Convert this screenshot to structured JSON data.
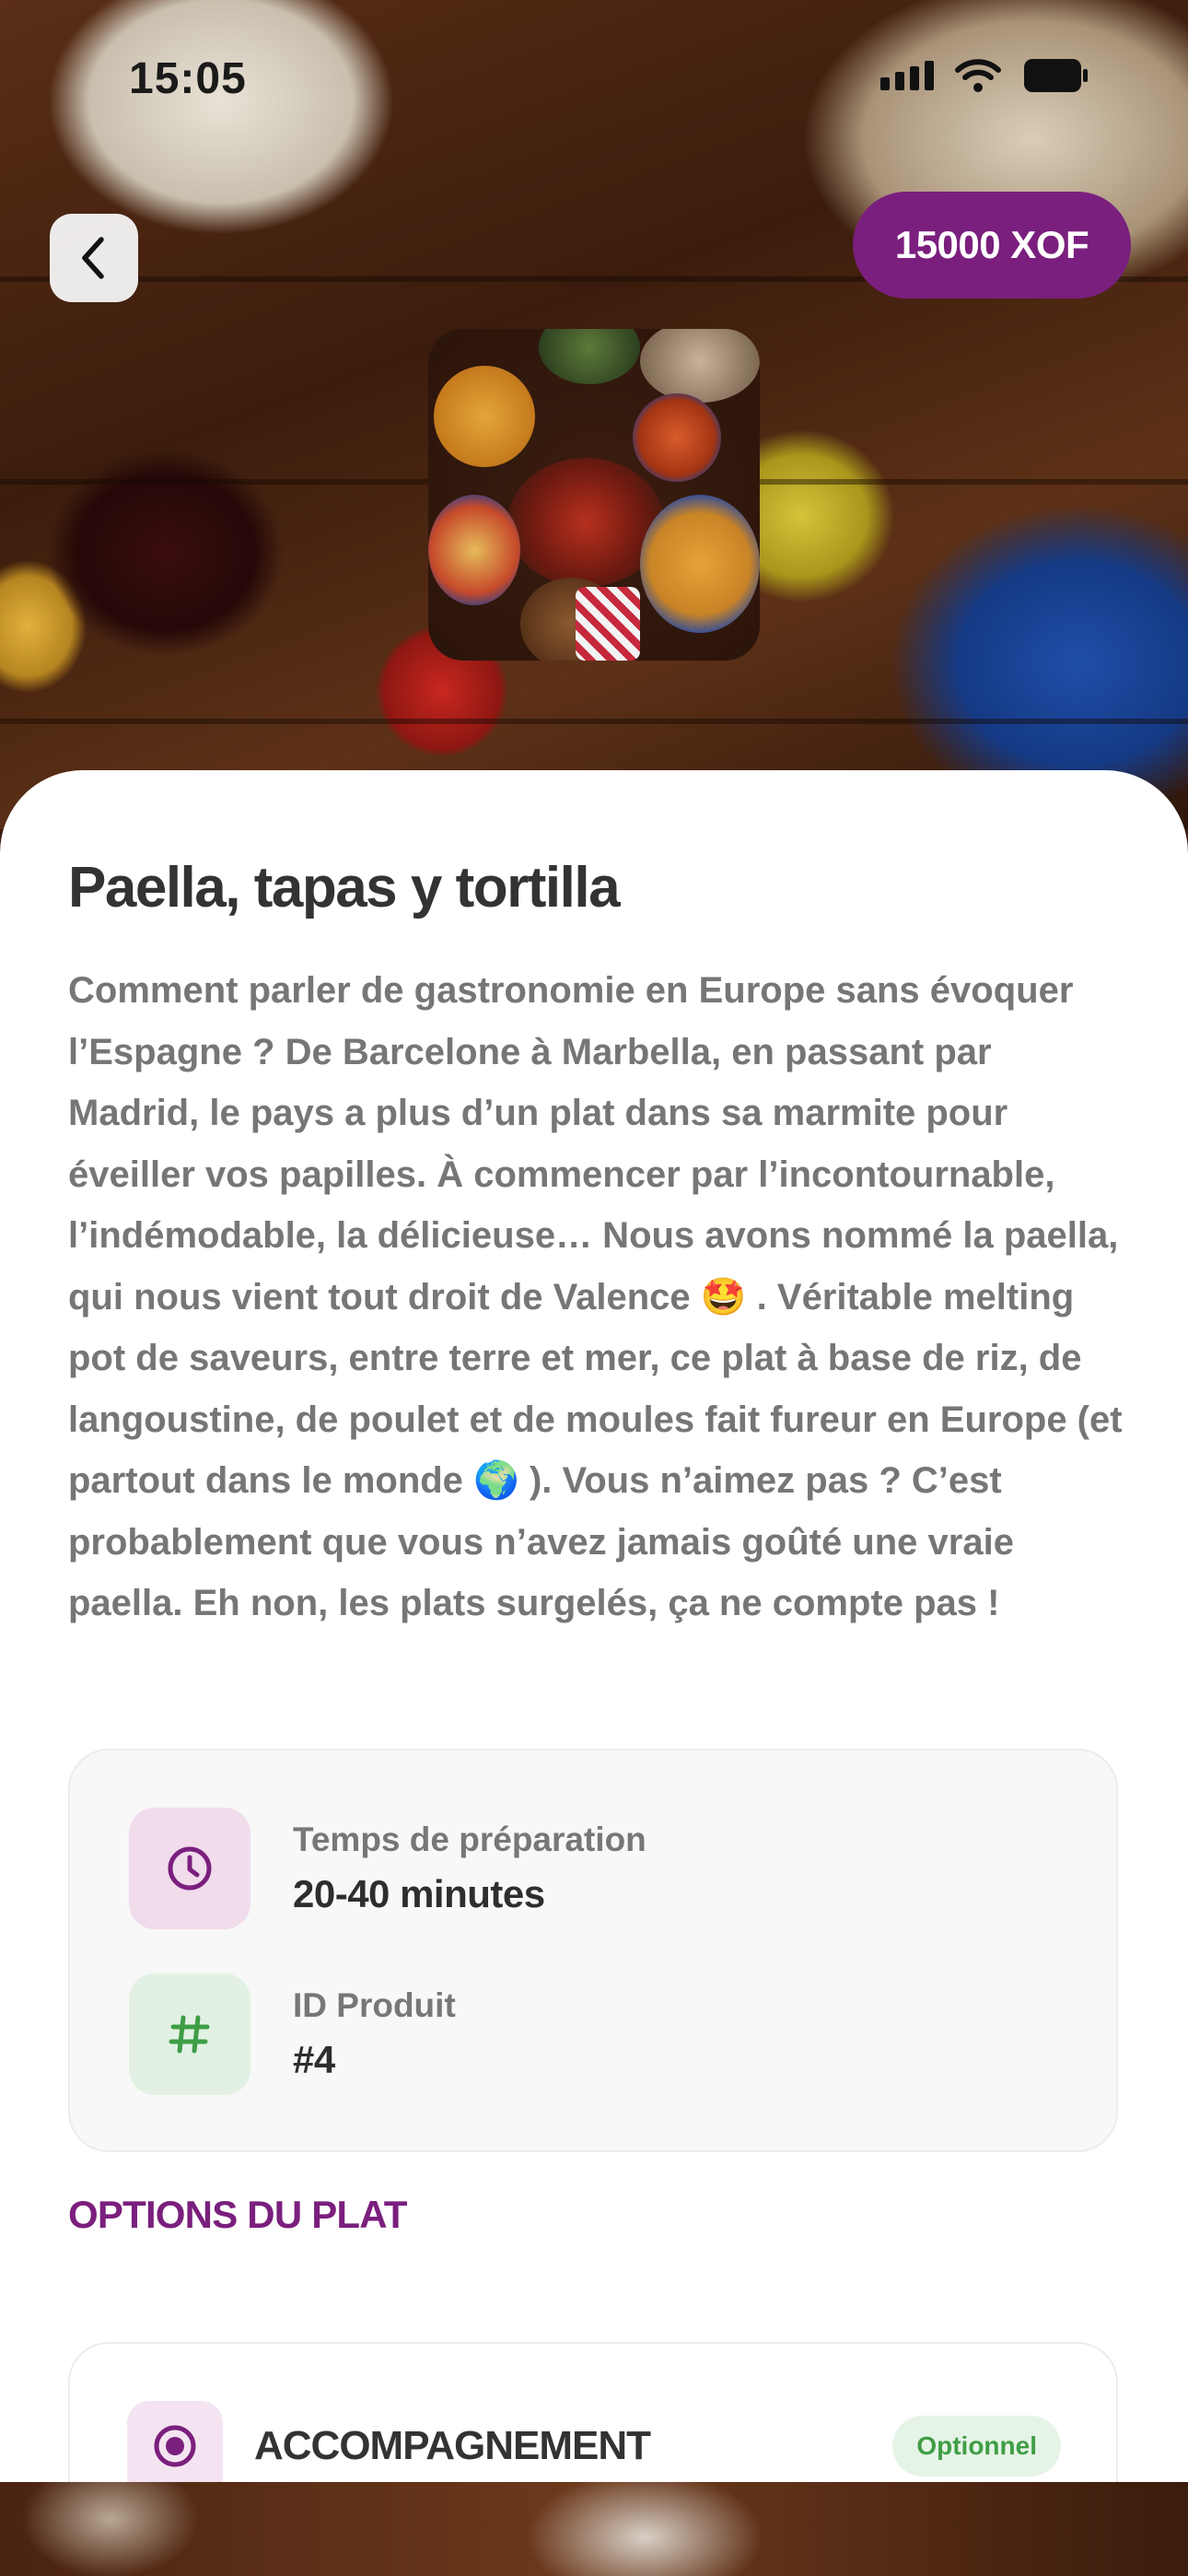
{
  "status_bar": {
    "time": "15:05",
    "battery": "76"
  },
  "header": {
    "price": "15000 XOF",
    "back_icon": "chevron-left-icon"
  },
  "product": {
    "title": "Paella, tapas y tortilla",
    "description": "Comment parler de gastronomie en Europe sans évoquer l’Espagne ? De Barcelone à Marbella, en passant par Madrid, le pays a plus d’un plat dans sa marmite pour éveiller vos papilles. À commencer par l’incontournable, l’indémodable, la délicieuse… Nous avons nommé la paella, qui nous vient tout droit de Valence 🤩 . Véritable melting pot de saveurs, entre terre et mer, ce plat à base de riz, de langoustine, de poulet et de moules fait fureur en Europe (et partout dans le monde 🌍 ). Vous n’aimez pas ? C’est probablement que vous n’avez jamais goûté une vraie paella. Eh non, les plats surgelés, ça ne compte pas !"
  },
  "info": {
    "prep_label": "Temps de préparation",
    "prep_value": "20-40 minutes",
    "prep_icon": "clock-icon",
    "id_label": "ID Produit",
    "id_value": "#4",
    "id_icon": "hash-icon"
  },
  "options": {
    "section_title": "OPTIONS DU PLAT",
    "items": [
      {
        "title": "ACCOMPAGNEMENT",
        "badge": "Optionnel",
        "icon": "radio-selected-icon"
      }
    ]
  },
  "colors": {
    "brand": "#7a1f7d",
    "success": "#3f9e45",
    "text_dark": "#333333",
    "text_muted": "#767676"
  }
}
